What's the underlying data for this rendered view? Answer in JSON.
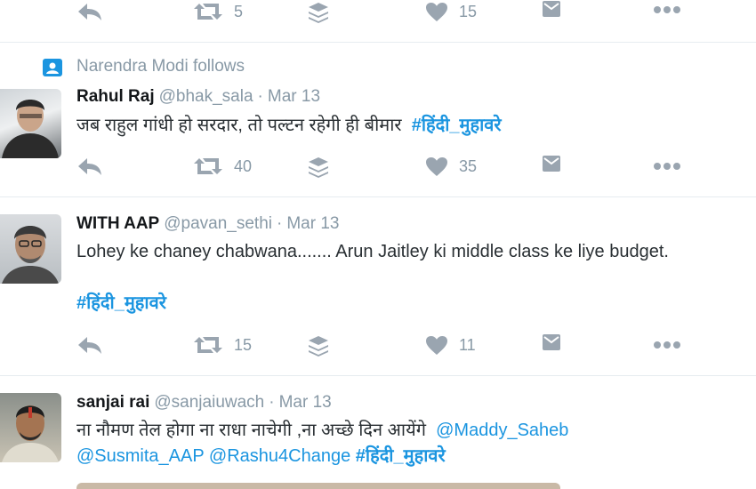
{
  "top_actions": {
    "retweets": "5",
    "likes": "15"
  },
  "social_context": "Narendra Modi follows",
  "tweets": [
    {
      "name": "Rahul Raj",
      "handle": "@bhak_sala",
      "dot": "·",
      "date": "Mar 13",
      "text": "जब राहुल गांधी हो सरदार, तो पल्टन रहेगी ही बीमार",
      "hashtag": "#हिंदी_मुहावरे",
      "retweets": "40",
      "likes": "35"
    },
    {
      "name": "WITH AAP",
      "handle": "@pavan_sethi",
      "dot": "·",
      "date": "Mar 13",
      "text": "Lohey ke chaney chabwana....... Arun Jaitley ki middle class ke liye budget.",
      "hashtag": "#हिंदी_मुहावरे",
      "retweets": "15",
      "likes": "11"
    },
    {
      "name": "sanjai rai",
      "handle": "@sanjaiuwach",
      "dot": "·",
      "date": "Mar 13",
      "text": "ना नौमण तेल होगा ना राधा नाचेगी ,ना अच्छे दिन आयेंगे",
      "mention1": "@Maddy_Saheb",
      "mention2": "@Susmita_AAP",
      "mention3": "@Rashu4Change",
      "hashtag": "#हिंदी_मुहावरे"
    }
  ],
  "colors": {
    "link": "#1b95e0",
    "icon": "#9aa5b0",
    "meta": "#8899a6"
  }
}
